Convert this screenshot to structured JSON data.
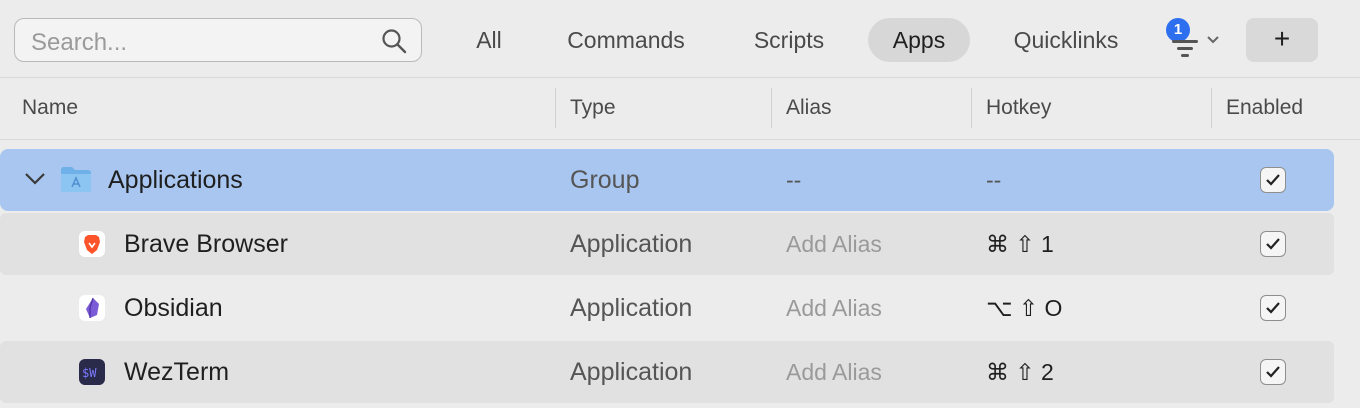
{
  "search": {
    "placeholder": "Search..."
  },
  "tabs": [
    {
      "label": "All"
    },
    {
      "label": "Commands"
    },
    {
      "label": "Scripts"
    },
    {
      "label": "Apps"
    },
    {
      "label": "Quicklinks"
    }
  ],
  "active_tab": "Apps",
  "filter": {
    "badge": "1"
  },
  "add_button": {
    "label": "+"
  },
  "columns": {
    "name": "Name",
    "type": "Type",
    "alias": "Alias",
    "hotkey": "Hotkey",
    "enabled": "Enabled"
  },
  "rows": [
    {
      "name": "Applications",
      "type": "Group",
      "alias": "--",
      "hotkey": "--",
      "enabled": true
    },
    {
      "name": "Brave Browser",
      "type": "Application",
      "alias": "Add Alias",
      "hotkey": "⌘ ⇧ 1",
      "enabled": true,
      "icon": "brave-icon"
    },
    {
      "name": "Obsidian",
      "type": "Application",
      "alias": "Add Alias",
      "hotkey": "⌥ ⇧ O",
      "enabled": true,
      "icon": "obsidian-icon"
    },
    {
      "name": "WezTerm",
      "type": "Application",
      "alias": "Add Alias",
      "hotkey": "⌘ ⇧ 2",
      "enabled": true,
      "icon": "wezterm-icon"
    }
  ],
  "colors": {
    "selection": "#a8c6f0",
    "badge": "#2e6ff0"
  }
}
